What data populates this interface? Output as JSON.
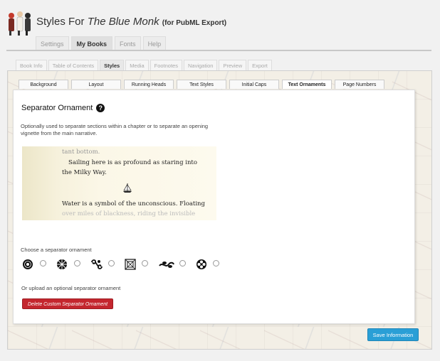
{
  "header": {
    "title_prefix": "Styles For ",
    "book_title": "The Blue Monk",
    "subtitle": "(for PubML Export)"
  },
  "main_tabs": [
    {
      "label": "Settings",
      "active": false
    },
    {
      "label": "My Books",
      "active": true
    },
    {
      "label": "Fonts",
      "active": false
    },
    {
      "label": "Help",
      "active": false
    }
  ],
  "book_tabs": [
    {
      "label": "Book Info",
      "active": false
    },
    {
      "label": "Table of Contents",
      "active": false
    },
    {
      "label": "Styles",
      "active": true
    },
    {
      "label": "Media",
      "active": false
    },
    {
      "label": "Footnotes",
      "active": false
    },
    {
      "label": "Navigation",
      "active": false
    },
    {
      "label": "Preview",
      "active": false
    },
    {
      "label": "Export",
      "active": false
    }
  ],
  "style_tabs": [
    {
      "label": "Background",
      "active": false
    },
    {
      "label": "Layout",
      "active": false
    },
    {
      "label": "Running Heads",
      "active": false
    },
    {
      "label": "Text Styles",
      "active": false
    },
    {
      "label": "Initial Caps",
      "active": false
    },
    {
      "label": "Text Ornaments",
      "active": true
    },
    {
      "label": "Page Numbers",
      "active": false
    }
  ],
  "panel": {
    "title": "Separator Ornament",
    "help_glyph": "?",
    "description": "Optionally used to separate sections within a chapter or to separate an opening vignette from the main narrative.",
    "preview": {
      "line1": "tant bottom.",
      "line2": "Sailing here is as profound as staring into",
      "line3": "the Milky Way.",
      "line4": "Water is a symbol of the unconscious. Floating",
      "line5": "over miles of blackness, riding the invisible"
    },
    "choose_label": "Choose a separator ornament",
    "ornaments": [
      {
        "icon": "rosette-ornament-icon",
        "selected": false
      },
      {
        "icon": "compass-star-ornament-icon",
        "selected": false
      },
      {
        "icon": "scroll-swirl-ornament-icon",
        "selected": false
      },
      {
        "icon": "square-knot-ornament-icon",
        "selected": false
      },
      {
        "icon": "leaf-vine-ornament-icon",
        "selected": false
      },
      {
        "icon": "flower-ornament-icon",
        "selected": false
      }
    ],
    "upload_label": "Or upload an optional separator ornament",
    "delete_button": "Delete Custom Separator Ornament"
  },
  "save_button": "Save Information",
  "colors": {
    "delete_button": "#c4262e",
    "save_button": "#2a9fd6",
    "panel_bg": "#ffffff"
  }
}
